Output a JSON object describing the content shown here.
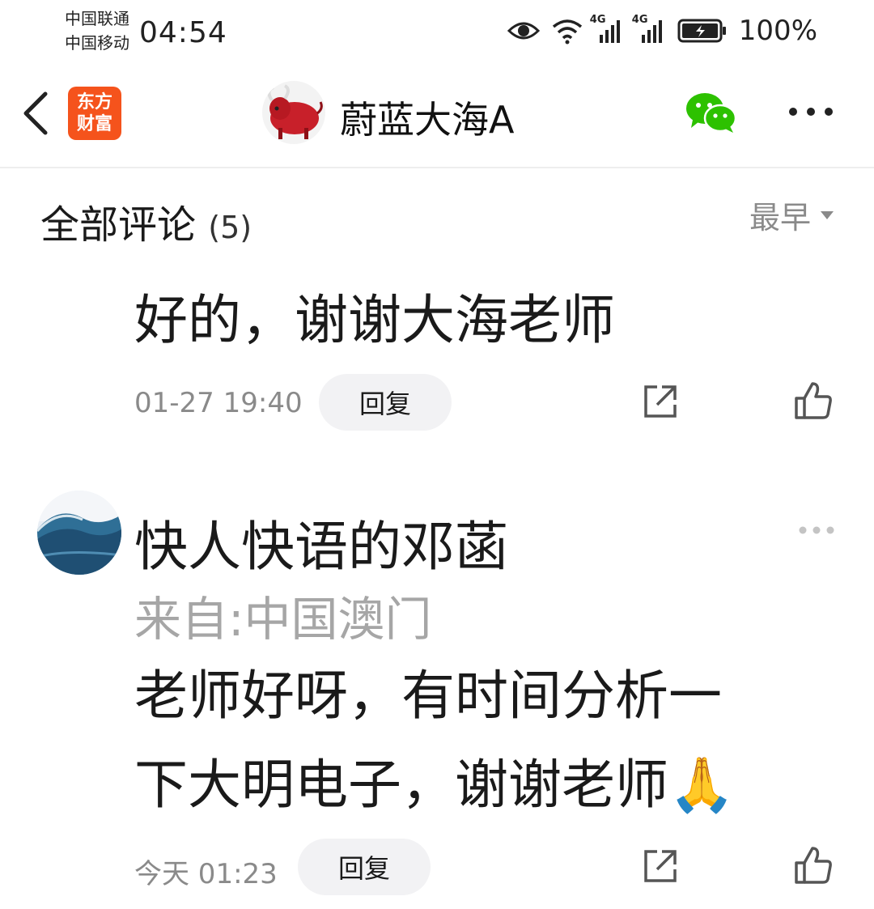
{
  "status_bar": {
    "carrier_1": "中国联通",
    "carrier_2": "中国移动",
    "time": "04:54",
    "network_1": "4G",
    "network_2": "4G",
    "battery": "100%"
  },
  "header": {
    "app_logo_line1": "东方",
    "app_logo_line2": "财富",
    "title": "蔚蓝大海A"
  },
  "comments_section": {
    "title": "全部评论",
    "count": "(5)",
    "sort_label": "最早"
  },
  "comments": [
    {
      "text": "好的，谢谢大海老师",
      "time": "01-27 19:40",
      "reply_label": "回复"
    },
    {
      "username": "快人快语的邓菡",
      "location": "来自:中国澳门",
      "text_line1": "老师好呀，有时间分析一",
      "text_line2": "下大明电子，谢谢老师🙏",
      "time": "今天 01:23",
      "reply_label": "回复"
    }
  ],
  "colors": {
    "logo_orange": "#f5531c",
    "wechat_green": "#2dc100",
    "muted_text": "#8a8a8a"
  }
}
